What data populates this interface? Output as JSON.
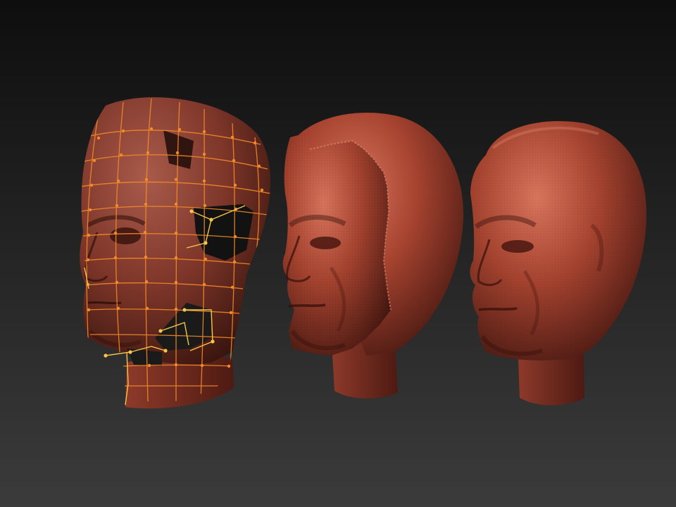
{
  "viewport": {
    "background_top": "#0e0e0e",
    "background_bottom": "#3b3b3b"
  },
  "material": {
    "base_color": "#a4422f",
    "highlight_color": "#d9745c",
    "shadow_color": "#3e140e",
    "wire_color": "#f28a2a",
    "selected_wire_color": "#f7c54a"
  },
  "models": [
    {
      "name": "head-low-poly-cage",
      "state": "partial wireframe cage"
    },
    {
      "name": "head-partial-projection",
      "state": "partial detail"
    },
    {
      "name": "head-fully-sculpted",
      "state": "complete"
    }
  ]
}
